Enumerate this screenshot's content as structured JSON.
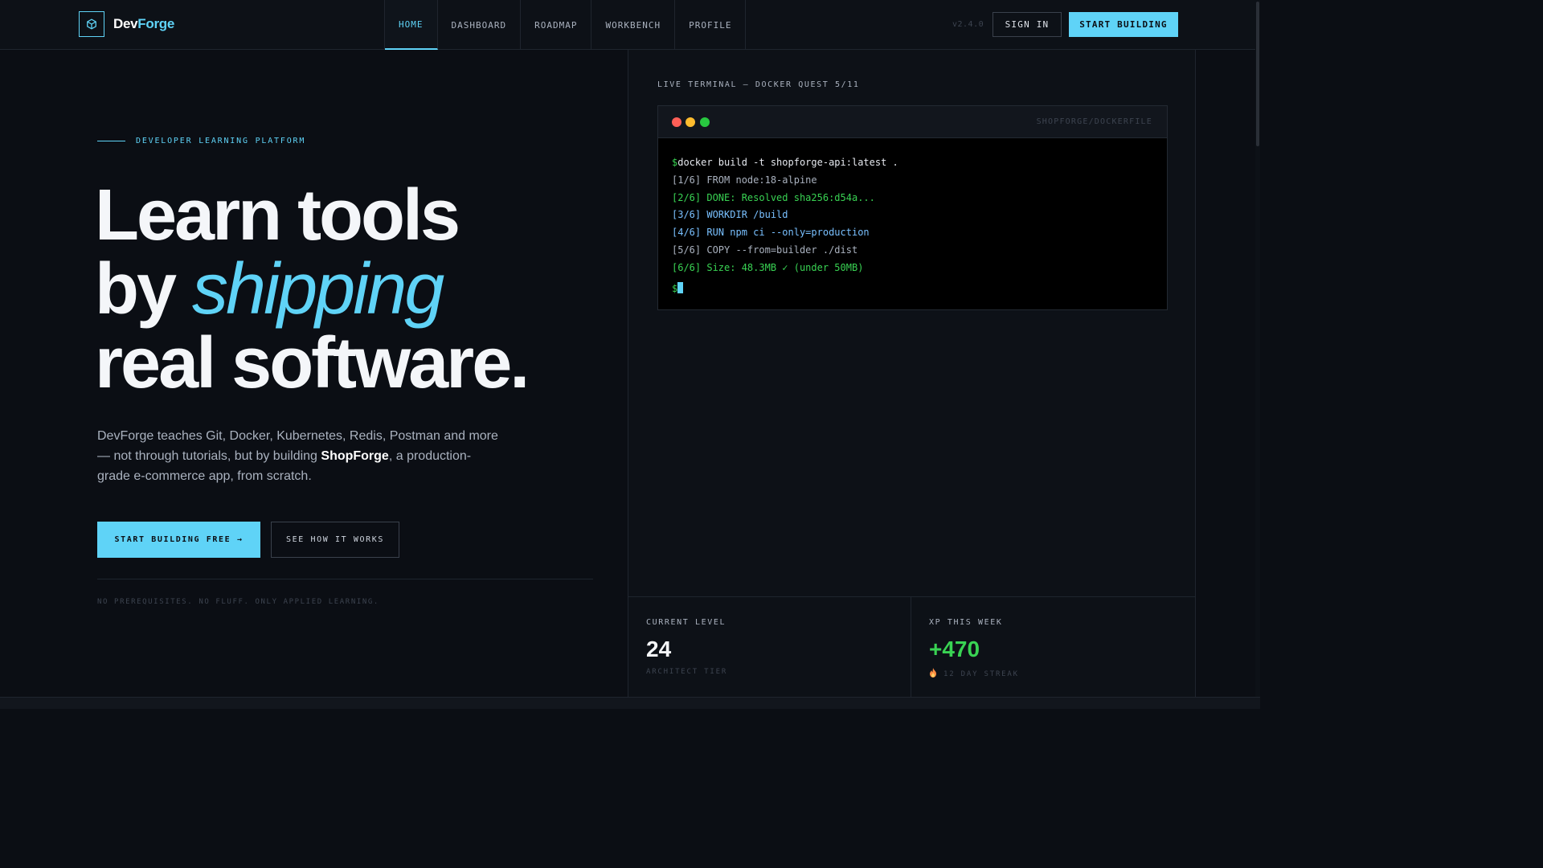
{
  "brand": {
    "name_part1": "Dev",
    "name_part2": "Forge",
    "logo_icon": "cube-icon",
    "accent_color": "#5fd3f7"
  },
  "nav": {
    "items": [
      {
        "label": "HOME",
        "active": true
      },
      {
        "label": "DASHBOARD",
        "active": false
      },
      {
        "label": "ROADMAP",
        "active": false
      },
      {
        "label": "WORKBENCH",
        "active": false
      },
      {
        "label": "PROFILE",
        "active": false
      }
    ],
    "version": "v2.4.0",
    "sign_in": "SIGN IN",
    "start_building": "START BUILDING"
  },
  "hero": {
    "eyebrow": "DEVELOPER LEARNING PLATFORM",
    "headline_line1": "Learn tools",
    "headline_line2_prefix": "by ",
    "headline_line2_accent": "shipping",
    "headline_line3": "real software.",
    "desc_part1": "DevForge teaches Git, Docker, Kubernetes, Redis, Postman and more — not through tutorials, but by building ",
    "desc_strong": "ShopForge",
    "desc_part2": ", a production-grade e-commerce app, from scratch.",
    "cta_primary": "START BUILDING FREE →",
    "cta_secondary": "SEE HOW IT WORKS",
    "footnote": "NO PREREQUISITES. NO FLUFF. ONLY APPLIED LEARNING."
  },
  "terminal": {
    "label": "LIVE TERMINAL — DOCKER QUEST 5/11",
    "file": "SHOPFORGE/DOCKERFILE",
    "prompt": "$",
    "command": "docker build -t shopforge-api:latest .",
    "lines": [
      {
        "text": "[1/6] FROM node:18-alpine",
        "color": "gray"
      },
      {
        "text": "[2/6] DONE: Resolved sha256:d54a...",
        "color": "green"
      },
      {
        "text": "[3/6] WORKDIR /build",
        "color": "blue"
      },
      {
        "text": "[4/6] RUN npm ci --only=production",
        "color": "blue"
      },
      {
        "text": "[5/6] COPY --from=builder ./dist",
        "color": "gray"
      },
      {
        "text": "[6/6] Size: 48.3MB ✓ (under 50MB)",
        "color": "green"
      }
    ],
    "final_prompt": "$"
  },
  "stats": {
    "level": {
      "label": "CURRENT LEVEL",
      "value": "24",
      "sub": "ARCHITECT TIER"
    },
    "xp": {
      "label": "XP THIS WEEK",
      "value": "+470",
      "sub": "12 DAY STREAK",
      "icon": "flame-icon"
    }
  }
}
